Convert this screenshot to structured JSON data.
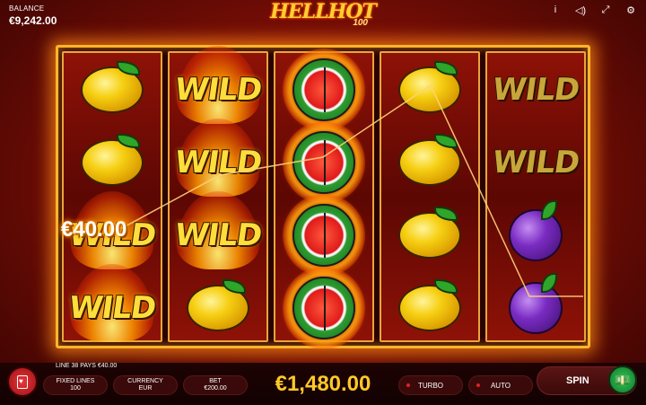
{
  "balance": {
    "label": "BALANCE",
    "value": "€9,242.00"
  },
  "logo": {
    "title": "HELLHOT",
    "subtitle": "100"
  },
  "top_icons": [
    "info-icon",
    "sound-icon",
    "fullscreen-icon",
    "settings-icon"
  ],
  "reels": [
    [
      "lemon",
      "lemon",
      "wild",
      "wild"
    ],
    [
      "wild",
      "wild",
      "wild",
      "lemon"
    ],
    [
      "watermelon",
      "watermelon",
      "watermelon",
      "watermelon"
    ],
    [
      "lemon",
      "lemon",
      "lemon",
      "lemon"
    ],
    [
      "wild",
      "wild",
      "plum",
      "plum"
    ]
  ],
  "symbols": {
    "wild_text": "WILD"
  },
  "win_popup": "€40.00",
  "line_info": "LINE 38 PAYS €40.00",
  "controls": {
    "fixed_lines_label": "FIXED LINES",
    "fixed_lines_value": "100",
    "currency_label": "CURRENCY",
    "currency_value": "EUR",
    "bet_label": "BET",
    "bet_value": "€200.00",
    "win_total": "€1,480.00",
    "turbo_label": "TURBO",
    "auto_label": "AUTO",
    "spin_label": "SPIN"
  },
  "colors": {
    "accent": "#ffc928",
    "frame": "#ffb52b",
    "background": "#7a0e06"
  }
}
